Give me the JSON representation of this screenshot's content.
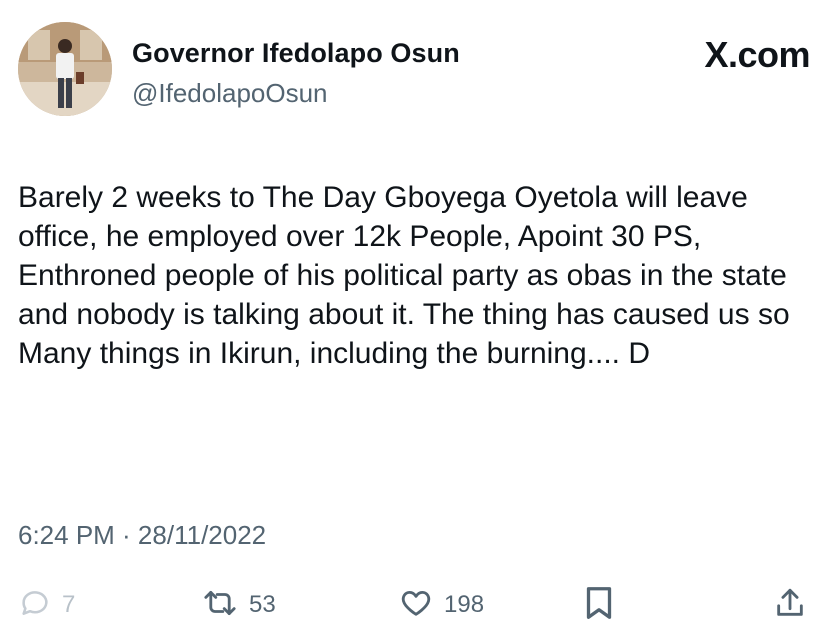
{
  "header": {
    "display_name": "Governor Ifedolapo Osun",
    "handle": "@IfedolapoOsun",
    "brand": "X.com"
  },
  "tweet": {
    "text": "Barely 2 weeks to The Day Gboyega Oyetola will leave office, he employed over 12k People, Apoint 30 PS, Enthroned people of his political party as obas in the state and nobody is talking about it. The thing has caused us so Many things in Ikirun, including the burning.... D",
    "timestamp": "6:24 PM · 28/11/2022"
  },
  "actions": {
    "replies": "7",
    "retweets": "53",
    "likes": "198"
  },
  "icons": [
    "reply-icon",
    "retweet-icon",
    "like-icon",
    "bookmark-icon",
    "share-icon"
  ],
  "colors": {
    "text": "#0f1419",
    "secondary": "#536471",
    "reply_faded": "#b8c1c9"
  }
}
